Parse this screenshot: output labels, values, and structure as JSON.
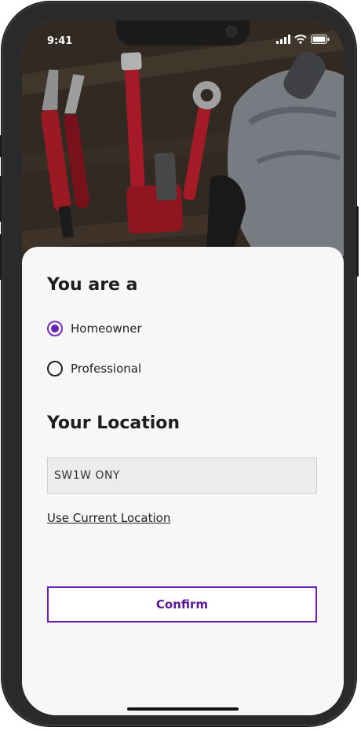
{
  "status_bar": {
    "time": "9:41"
  },
  "hero": {
    "image_description_icon": "tools-photo"
  },
  "role": {
    "heading": "You are a",
    "options": [
      {
        "label": "Homeowner",
        "selected": true
      },
      {
        "label": "Professional",
        "selected": false
      }
    ]
  },
  "location": {
    "heading": "Your Location",
    "value": "SW1W ONY",
    "use_current_label": "Use Current Location"
  },
  "actions": {
    "confirm_label": "Confirm"
  },
  "colors": {
    "accent": "#6c1db3",
    "background": "#f7f7f7"
  }
}
